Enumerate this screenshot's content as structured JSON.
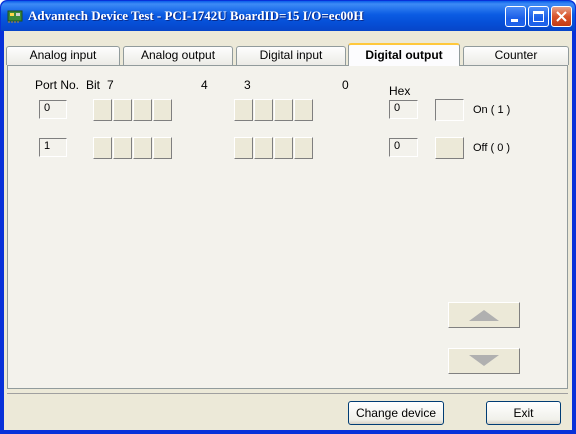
{
  "window": {
    "title": "Advantech Device Test - PCI-1742U BoardID=15 I/O=ec00H"
  },
  "tabs": [
    "Analog input",
    "Analog output",
    "Digital input",
    "Digital output",
    "Counter"
  ],
  "active_tab": "Digital output",
  "header": {
    "port_no": "Port No.",
    "bit": "Bit",
    "bit7": "7",
    "bit4": "4",
    "bit3": "3",
    "bit0": "0",
    "hex": "Hex"
  },
  "ports": [
    {
      "port": "0",
      "hex": "0"
    },
    {
      "port": "1",
      "hex": "0"
    }
  ],
  "legend": {
    "on": "On ( 1 )",
    "off": "Off ( 0 )"
  },
  "buttons": {
    "change_device": "Change device",
    "exit": "Exit"
  },
  "colors": {
    "titlebar": "#0b5ce3",
    "active_tab_accent": "#ffc83c"
  }
}
